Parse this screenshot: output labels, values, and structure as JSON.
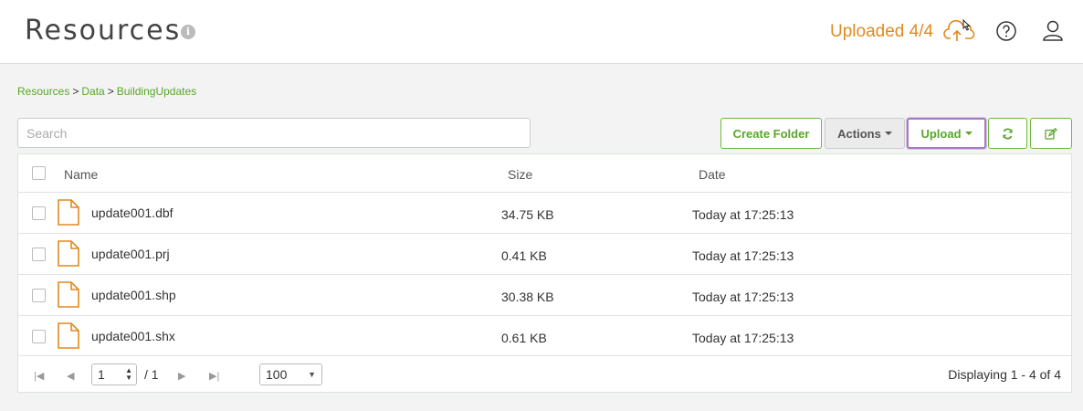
{
  "header": {
    "title": "Resources",
    "upload_status": "Uploaded 4/4",
    "icons": [
      "info-icon",
      "cloud-upload-icon",
      "help-icon",
      "user-icon"
    ]
  },
  "breadcrumb": {
    "items": [
      "Resources",
      "Data",
      "BuildingUpdates"
    ],
    "separator": ">"
  },
  "search": {
    "placeholder": "Search",
    "value": ""
  },
  "toolbar": {
    "create_folder": "Create Folder",
    "actions": "Actions",
    "upload": "Upload"
  },
  "table": {
    "columns": [
      "Name",
      "Size",
      "Date"
    ],
    "rows": [
      {
        "name": "update001.dbf",
        "size": "34.75 KB",
        "date": "Today at 17:25:13"
      },
      {
        "name": "update001.prj",
        "size": "0.41 KB",
        "date": "Today at 17:25:13"
      },
      {
        "name": "update001.shp",
        "size": "30.38 KB",
        "date": "Today at 17:25:13"
      },
      {
        "name": "update001.shx",
        "size": "0.61 KB",
        "date": "Today at 17:25:13"
      }
    ]
  },
  "pager": {
    "page": "1",
    "of_total": "/ 1",
    "per_page": "100",
    "displaying": "Displaying 1 - 4 of 4"
  },
  "colors": {
    "accent_green": "#5aa62a",
    "accent_orange": "#e08a1e",
    "upload_focus": "#a67bc3"
  }
}
